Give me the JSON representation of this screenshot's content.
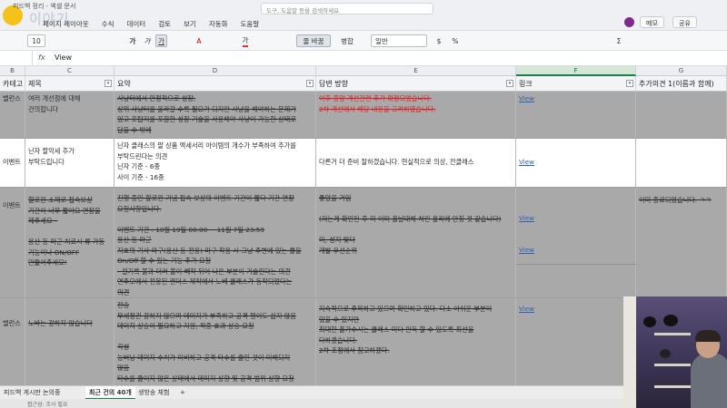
{
  "titlebar": {
    "doc_title": "피드백 정리 - 엑셀 문서",
    "logo_text": "이야기",
    "search_placeholder": "도구, 도움말 등을 검색하세요",
    "menu": [
      "페이지 레이아웃",
      "수식",
      "데이터",
      "검토",
      "보기",
      "자동화",
      "도움말"
    ],
    "comment_button": "메모",
    "share_button": "공유"
  },
  "ribbon": {
    "font_size": "10",
    "bold": "가",
    "italic": "가",
    "underline": "가",
    "wrap_text": "줄 바꿈",
    "merge": "병합",
    "number_format": "일반",
    "currency": "$",
    "percent": "%",
    "sum": "Σ"
  },
  "formula_bar": {
    "fx": "fx",
    "value": "View"
  },
  "columns": {
    "b": "B",
    "c": "C",
    "d": "D",
    "e": "E",
    "f": "F",
    "g": "G"
  },
  "headers": {
    "b": "카테고리",
    "c": "제목",
    "d": "요약",
    "e": "답변 방향",
    "f": "링크",
    "g": "추가의견 1(이름과 함께)"
  },
  "rows": [
    {
      "b": "밸런스",
      "c": [
        "여러 개선점에 대해",
        "건의합니다"
      ],
      "d": [
        "사냥터에서 안정적으로 성장,",
        "상위 사냥터를 올라갈 수록 필요가 되지만 사냥을 해야하는 문제가",
        "있고 포탑지를 포함한 성장 기술을 사용해야 사냥이 가능한 상태로",
        "답을 수 밖에",
        "이에 조금이라도 빨리 효과의 시간이 간 기술을 추가해 주하는 의견"
      ],
      "e": [
        "이후 중앙 개선관련 추가 확정되었습니다.",
        "2차 개선에서 해당 내용을 고려하였습니다."
      ],
      "f": "View",
      "g": ""
    },
    {
      "b": "이벤트",
      "c": [
        "닌자 팔악세 추가",
        "부탁드립니다"
      ],
      "d": [
        "닌자 클래스의 팔 상품 액세서리 아이템의 개수가 부족하여 추가를",
        "부탁드린다는 의견",
        "닌자 기준 - 6종",
        "사이 기준 - 16종"
      ],
      "e": [
        "다른거 더 준비 잘하겠습니다. 현실적으로 의상, 전클래스"
      ],
      "f": "View",
      "g": ""
    },
    {
      "b": "이벤트",
      "c": [
        "할로윈 소재로 접속보상",
        "기간이 너무 짧아요 연장을",
        "제주세요~",
        "",
        "용산 등 마군 치료시 류 가동",
        "기능이나 ON/OFF",
        "만들어주세요!"
      ],
      "d": [
        "진행 중인 할로윈 기념 접속 보상의 이벤트 기간이 짧다 기간 연장",
        "요청사항입니다.",
        "",
        "이벤트 기간 : 10월 19일 00:00 ~ 11월 7일 23:59",
        "용산 등 마군",
        "지효의 기사 마구(용산 등 전용) 마구 착용 시 그냥 주변에 있는 물을",
        "On/Off 할 수 있는 기능 추가 요청",
        "- 걸기록 볼과 더러 볼이 빼작 뒤어 나온 부분이 거슬린다는 의견",
        "연주오에서 전봉된 랜더스 제작에서 노베 클래스가 동작되었다는",
        "의견"
      ],
      "e": [
        "좋았을 거임",
        "",
        "(저는게 확인된 후 미 이미 흘날대해 처린 흘리에 만칭 것 같습니다)",
        "",
        "미, 성지 맞다",
        "개발 우선순위",
        "",
        "이미 좋리되었습니다. ㅋㅋ"
      ],
      "f": "View",
      "g": "이미 종료되었습니다. ㅋㅋ"
    },
    {
      "b": "밸런스",
      "c": [
        "노바는 강하지 않습니다"
      ],
      "d": [
        "전승",
        "무세정권 강하지 않으며 데미지가 부족하고 공격 평이도 쉽지 않음",
        "데미지 상승이 필요하고 지원, 적중 효과 상승 요청",
        "",
        "각성",
        "능버닝 데미지 수치가 미비하고 공격 타수를 줄인 것이 미해되지",
        "않음",
        "타수를 줄이지 않은 상태에서 데미지 상향 및 공격 범위 상향 요청"
      ],
      "e": [
        "지속적으로 주목하고 있으며 확인하고 있다. 다소 아쉬운 부분이",
        "있을 수 있지만",
        "최대한 플가수시는 클래스 미다 판독 할 수 있도록 최선을",
        "다하겠습니다.",
        "2차 조정에서 참고하겠다."
      ],
      "f": "View",
      "g": ""
    }
  ],
  "sheet_tabs": [
    "피드백 게시판 논의중",
    "최근 건의 40개",
    "생방송 체험",
    "+"
  ],
  "status": "접근성: 조사 필요"
}
